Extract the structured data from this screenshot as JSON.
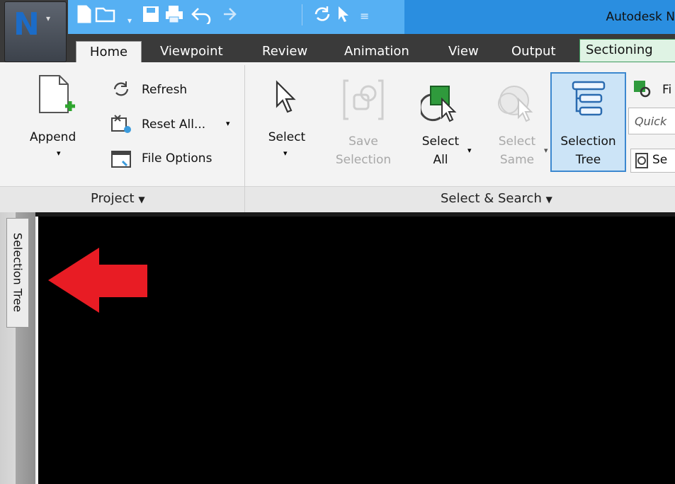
{
  "window": {
    "title": "Autodesk N"
  },
  "app_button": {
    "letter": "N"
  },
  "tabs": [
    "Home",
    "Viewpoint",
    "Review",
    "Animation",
    "View",
    "Output",
    "Sectioning"
  ],
  "project": {
    "append_label": "Append",
    "refresh_label": "Refresh",
    "reset_all_label": "Reset All...",
    "file_options_label": "File Options",
    "group_label": "Project"
  },
  "select_search": {
    "select_label": "Select",
    "save_selection_line1": "Save",
    "save_selection_line2": "Selection",
    "select_all_line1": "Select",
    "select_all_line2": "All",
    "select_same_line1": "Select",
    "select_same_line2": "Same",
    "selection_tree_line1": "Selection",
    "selection_tree_line2": "Tree",
    "find_items_label": "Fi",
    "quick_find_placeholder": "Quick",
    "sets_label": "Se",
    "group_label": "Select & Search"
  },
  "side_panel": {
    "tab_label": "Selection Tree"
  },
  "colors": {
    "title_bar": "#2a8ee0",
    "qat_bar": "#56b0f3",
    "tab_strip": "#3a3a3a",
    "sectioning_tab": "#dff3e4",
    "selected_button": "#cce4f7",
    "arrow": "#e81c24",
    "viewport": "#000000"
  },
  "icons": [
    "new-file-icon",
    "open-icon",
    "save-icon",
    "print-icon",
    "undo-icon",
    "redo-icon",
    "refresh-icon",
    "cursor-icon",
    "dropdown-icon",
    "append-icon",
    "reset-all-icon",
    "file-options-icon",
    "select-icon",
    "save-selection-icon",
    "select-all-icon",
    "select-same-icon",
    "selection-tree-icon",
    "find-items-icon",
    "sets-icon",
    "red-arrow"
  ]
}
